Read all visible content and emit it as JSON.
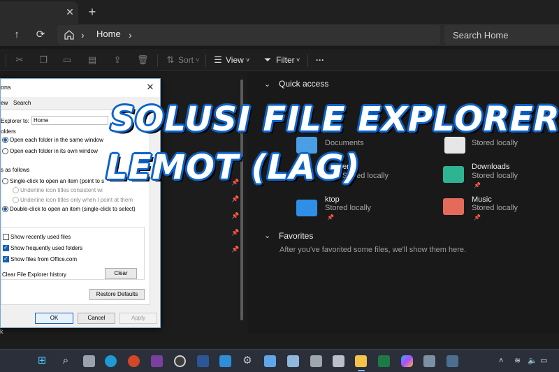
{
  "window": {
    "tab_close": "✕",
    "tab_new": "+"
  },
  "navbar": {
    "up_icon": "↑",
    "refresh_icon": "⟳",
    "chevron": "›",
    "location": "Home",
    "search_placeholder": "Search Home"
  },
  "commandbar": {
    "sort": "Sort",
    "view": "View",
    "filter": "Filter",
    "more": "···",
    "dropdown_caret": "˅"
  },
  "content": {
    "quick_access": "Quick access",
    "favorites": "Favorites",
    "favorites_note": "After you've favorited some files, we'll show them here.",
    "items": [
      {
        "title": "",
        "sub": "Documents"
      },
      {
        "title": "",
        "sub": "Stored locally"
      },
      {
        "title": "ents",
        "sub": "Stored locally"
      },
      {
        "title": "Downloads",
        "sub": "Stored locally"
      },
      {
        "title": "ktop",
        "sub": "Stored locally"
      },
      {
        "title": "Music",
        "sub": "Stored locally"
      }
    ],
    "item_pin": "📌"
  },
  "dialog": {
    "title": "ons",
    "close": "✕",
    "tabs": [
      "ew",
      "Search"
    ],
    "open_label": "Explorer to:",
    "open_value": "Home",
    "browse_group": "olders",
    "browse_same": "Open each folder in the same window",
    "browse_own": "Open each folder in its own window",
    "click_group": "s as follows",
    "single_click": "Single-click to open an item (point to s",
    "underline_consistent": "Underline icon titles consistent wi",
    "underline_point": "Underline icon titles only when I point at them",
    "double_click": "Double-click to open an item (single-click to select)",
    "show_recent": "Show recently used files",
    "show_frequent": "Show frequently used folders",
    "show_office": "Show files from Office.com",
    "clear_history": "Clear File Explorer history",
    "clear_btn": "Clear",
    "restore_btn": "Restore Defaults",
    "ok_btn": "OK",
    "cancel_btn": "Cancel",
    "apply_btn": "Apply"
  },
  "status": {
    "text": "k"
  },
  "overlay": {
    "line1": "SOLUSI  FILE  EXPLORER",
    "line2": "LEMOT (LAG)"
  },
  "taskbar": {
    "tray_chevron": "˄"
  },
  "colors": {
    "overlay_outline": "#0d63c9",
    "accent": "#1a5fb4"
  }
}
